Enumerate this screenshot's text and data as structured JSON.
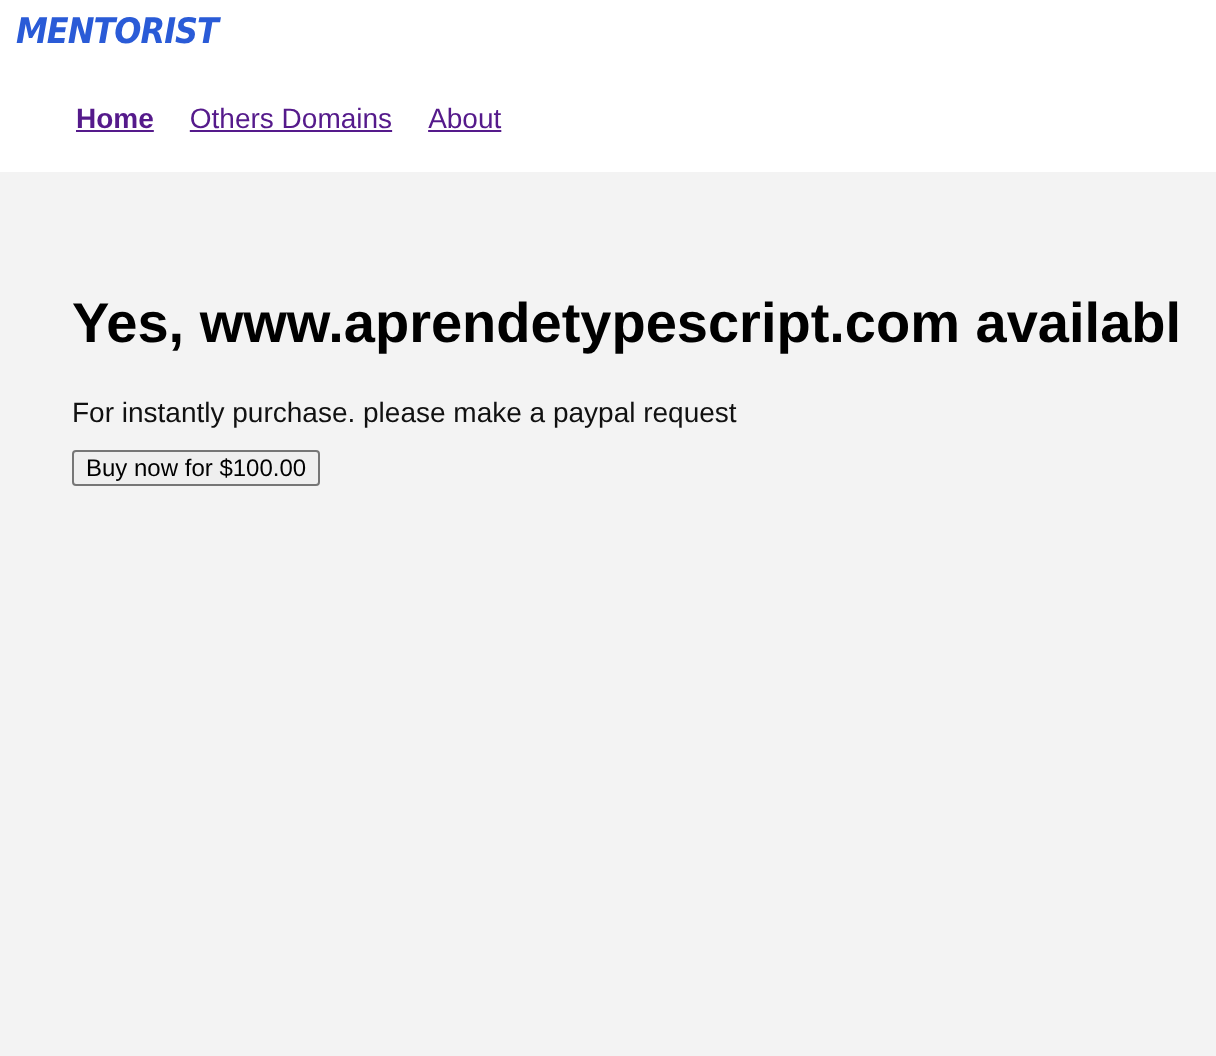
{
  "logo": "MENTORIST",
  "nav": [
    {
      "label": "Home",
      "selected": true
    },
    {
      "label": "Others Domains",
      "selected": false
    },
    {
      "label": "About",
      "selected": false
    }
  ],
  "heading": "Yes, www.aprendetypescript.com availabl",
  "message": "For instantly purchase. please make a paypal request",
  "buy_button": "Buy now for $100.00"
}
